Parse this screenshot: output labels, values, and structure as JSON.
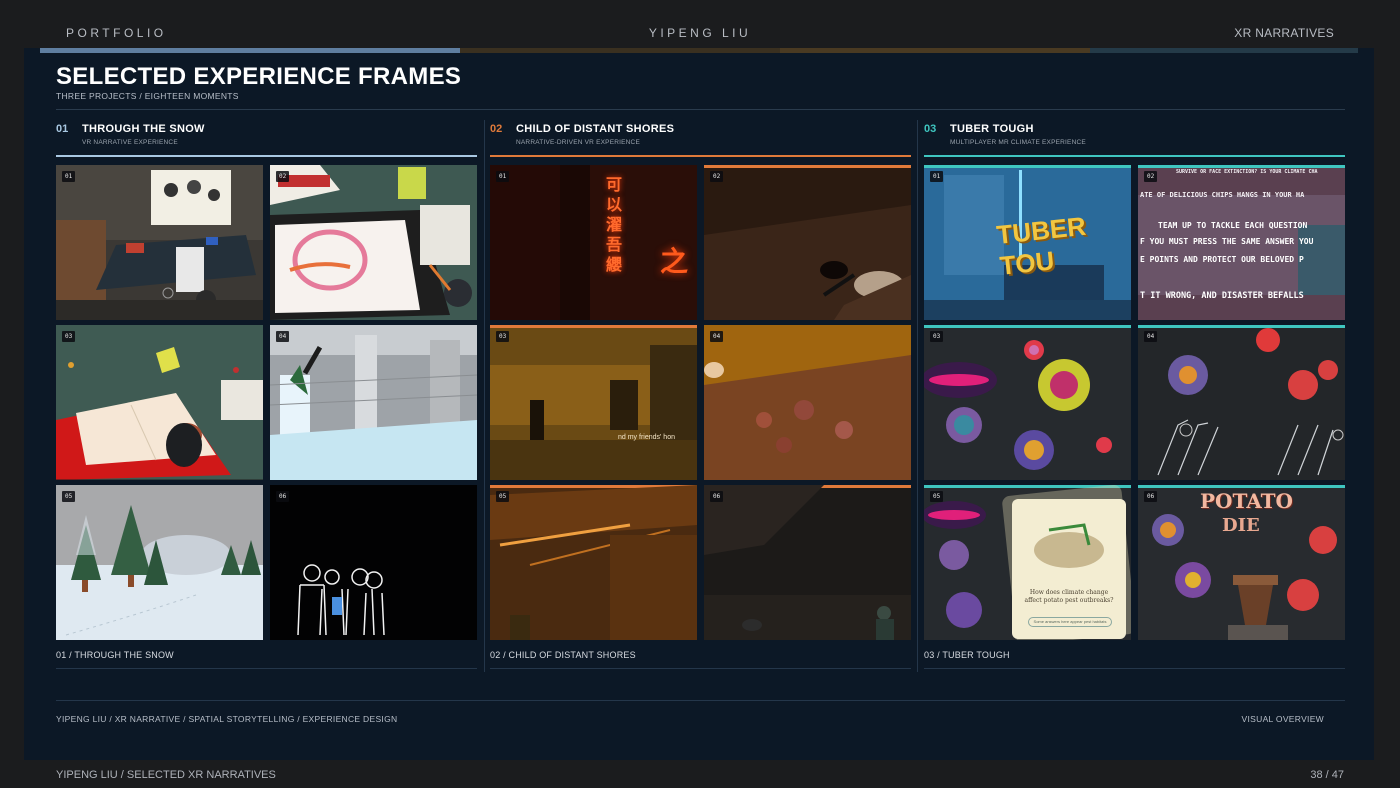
{
  "header": {
    "left": "PORTFOLIO",
    "center": "YIPENG LIU",
    "right": "XR NARRATIVES"
  },
  "slide": {
    "title": "SELECTED EXPERIENCE FRAMES",
    "subtitle": "THREE PROJECTS / EIGHTEEN MOMENTS",
    "footer_left": "YIPENG LIU  /  XR NARRATIVE  /  SPATIAL STORYTELLING  /  EXPERIENCE DESIGN",
    "footer_right": "VISUAL OVERVIEW"
  },
  "columns": [
    {
      "number": "01",
      "title": "THROUGH THE SNOW",
      "subtitle": "VR NARRATIVE EXPERIENCE",
      "accent": "#a9c8e2",
      "caption": "01  /  THROUGH THE SNOW",
      "frames": [
        "01",
        "02",
        "03",
        "04",
        "05",
        "06"
      ]
    },
    {
      "number": "02",
      "title": "CHILD OF DISTANT SHORES",
      "subtitle": "NARRATIVE-DRIVEN VR EXPERIENCE",
      "accent": "#e07a3a",
      "caption": "02  /  CHILD OF DISTANT SHORES",
      "frames": [
        "01",
        "02",
        "03",
        "04",
        "05",
        "06"
      ],
      "in_scene_text": {
        "vertical_glyphs": "可以濯吾纓",
        "second_glyph": "之",
        "sign": "nd my friends' hon"
      }
    },
    {
      "number": "03",
      "title": "TUBER TOUGH",
      "subtitle": "MULTIPLAYER MR CLIMATE EXPERIENCE",
      "accent": "#3fc6c0",
      "caption": "03  /  TUBER TOUGH",
      "frames": [
        "01",
        "02",
        "03",
        "04",
        "05",
        "06"
      ],
      "in_scene_text": {
        "logo": "TUBER TOU",
        "rules_lines": [
          "SURVIVE OR FACE EXTINCTION? IS YOUR CLIMATE CHA",
          "ATE OF DELICIOUS CHIPS HANGS IN YOUR HA",
          "TEAM UP TO TACKLE EACH QUESTION",
          "F YOU MUST PRESS THE SAME ANSWER YOU",
          "E POINTS AND PROTECT OUR BELOVED P",
          "T IT WRONG, AND DISASTER BEFALLS"
        ],
        "card_question": "How does climate change affect potato pest outbreaks?",
        "card_answer": "Some answers here appear pest habitats",
        "sign_line_1": "POTATO",
        "sign_line_2": "DIE"
      }
    }
  ],
  "footer": {
    "left": "YIPENG LIU  /  SELECTED XR NARRATIVES",
    "right": "38 / 47"
  },
  "colors": {
    "page_bg": "#1b1c1e",
    "slide_bg": "#0c1826",
    "accent_1": "#a9c8e2",
    "accent_2": "#e07a3a",
    "accent_3": "#3fc6c0"
  }
}
